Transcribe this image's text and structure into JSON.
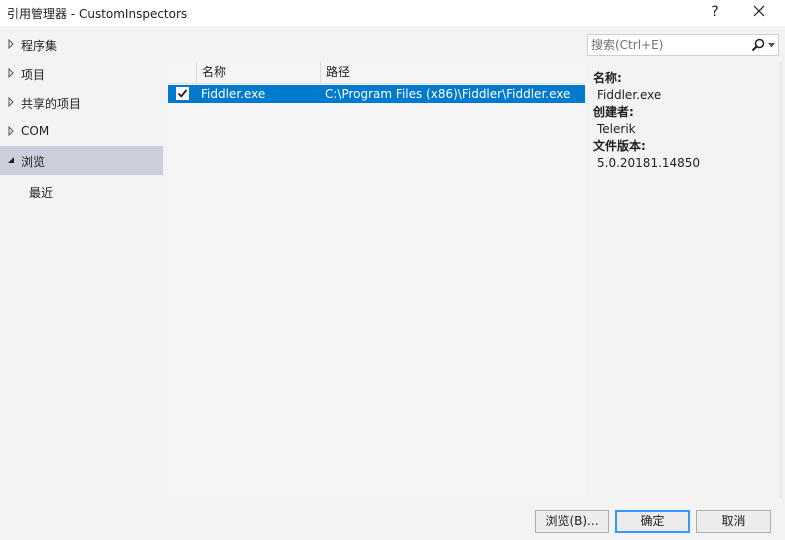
{
  "window": {
    "title": "引用管理器 - CustomInspectors",
    "help_label": "?"
  },
  "nav": {
    "items": [
      {
        "label": "程序集"
      },
      {
        "label": "项目"
      },
      {
        "label": "共享的项目"
      },
      {
        "label": "COM"
      },
      {
        "label": "浏览",
        "selected": true
      },
      {
        "label": "最近"
      }
    ]
  },
  "list": {
    "columns": [
      "名称",
      "路径"
    ],
    "rows": [
      {
        "checked": true,
        "name": "Fiddler.exe",
        "path": "C:\\Program Files (x86)\\Fiddler\\Fiddler.exe"
      }
    ]
  },
  "search": {
    "placeholder": "搜索(Ctrl+E)"
  },
  "details": [
    {
      "key": "名称:",
      "value": "Fiddler.exe"
    },
    {
      "key": "创建者:",
      "value": "Telerik"
    },
    {
      "key": "文件版本:",
      "value": "5.0.20181.14850"
    }
  ],
  "buttons": {
    "browse": "浏览(B)...",
    "ok": "确定",
    "cancel": "取消"
  },
  "colors": {
    "accent": "#007acc",
    "selected_nav": "#cccedb"
  }
}
